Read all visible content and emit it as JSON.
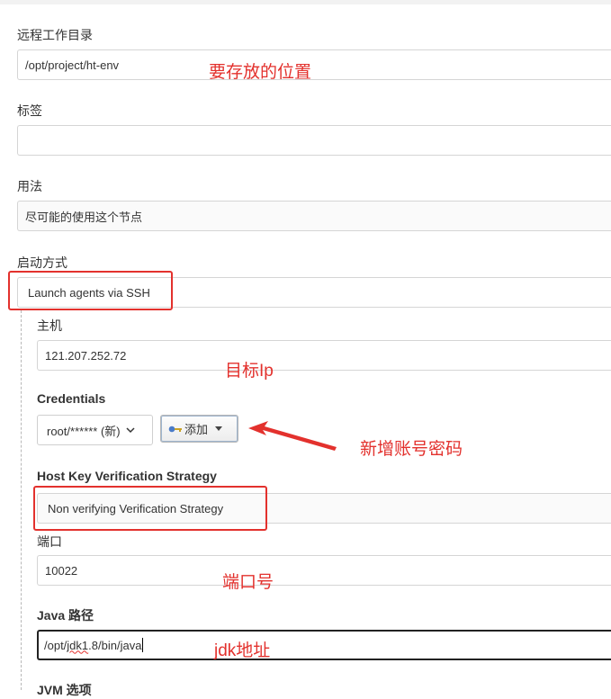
{
  "fields": {
    "remote_dir": {
      "label": "远程工作目录",
      "value": "/opt/project/ht-env"
    },
    "tags": {
      "label": "标签",
      "value": ""
    },
    "usage": {
      "label": "用法",
      "value": "尽可能的使用这个节点"
    },
    "launch": {
      "label": "启动方式",
      "value": "Launch agents via SSH"
    },
    "host": {
      "label": "主机",
      "value": "121.207.252.72"
    },
    "credentials": {
      "label": "Credentials",
      "value": "root/****** (新)",
      "add_label": "添加"
    },
    "host_key": {
      "label": "Host Key Verification Strategy",
      "value": "Non verifying Verification Strategy"
    },
    "port": {
      "label": "端口",
      "value": "10022"
    },
    "java_path": {
      "label": "Java 路径",
      "value_prefix": "/opt/",
      "value_wavy": "jdk1",
      "value_suffix": ".8/bin/java"
    },
    "jvm": {
      "label": "JVM 选项"
    }
  },
  "annotations": {
    "location": "要存放的位置",
    "target_ip": "目标Ip",
    "new_account": "新增账号密码",
    "port_no": "端口号",
    "jdk_addr": "jdk地址"
  },
  "colors": {
    "annotation_red": "#e3312d"
  },
  "icons": {
    "add_key": "key-icon",
    "dropdown": "chevron-down-icon"
  }
}
